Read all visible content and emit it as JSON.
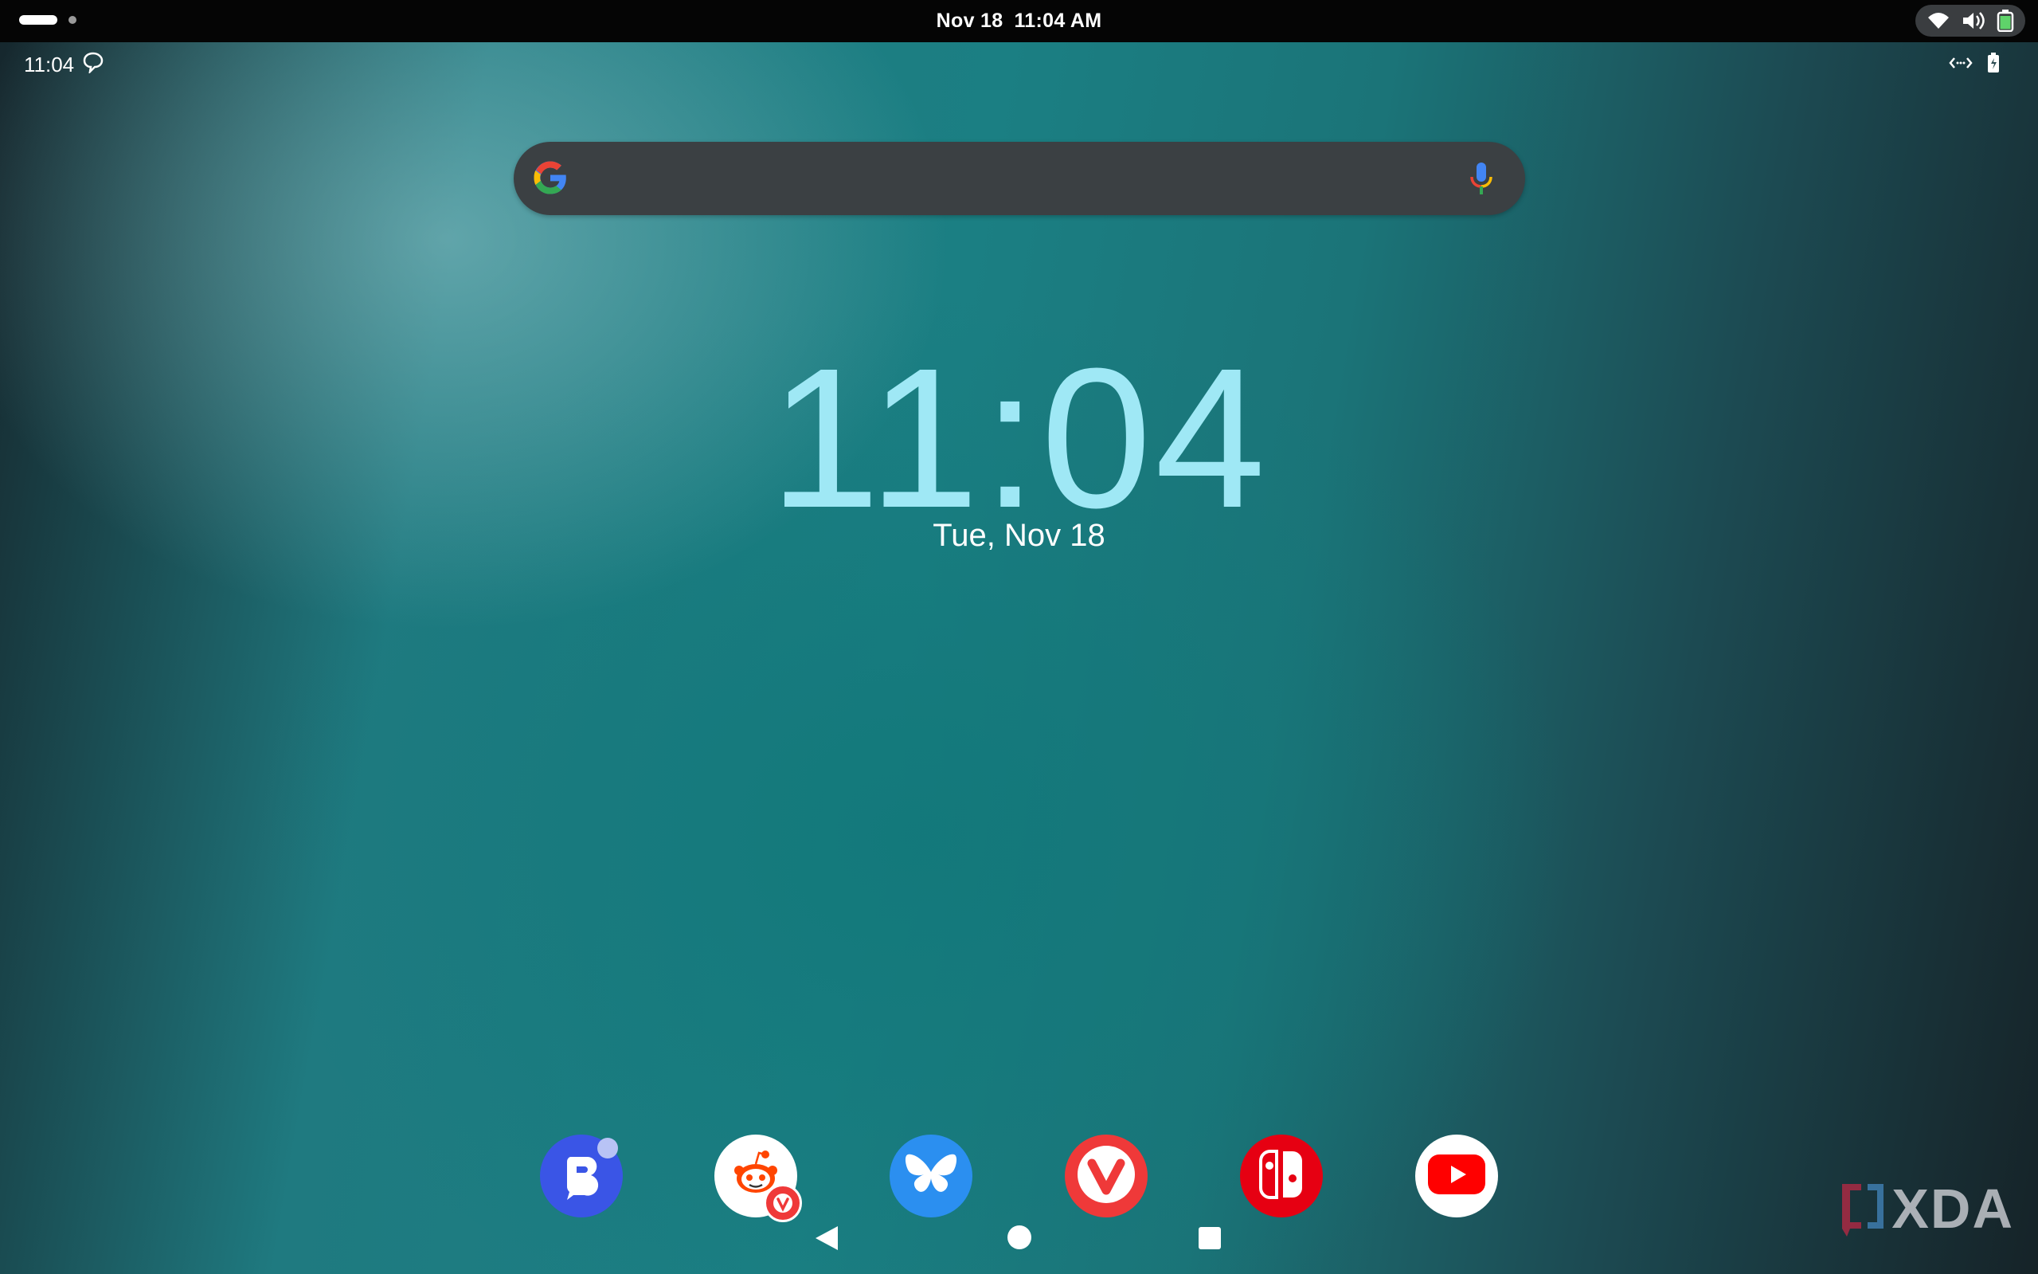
{
  "topbar": {
    "date": "Nov 18",
    "time": "11:04 AM",
    "tray_icons": [
      "wifi-icon",
      "volume-icon",
      "battery-charging-icon"
    ]
  },
  "android_status": {
    "time": "11:04",
    "left_icon": "speech-bubble-icon",
    "right_icons": [
      "code-arrows-icon",
      "battery-icon"
    ]
  },
  "search": {
    "placeholder": "",
    "left_icon": "google-logo-icon",
    "right_icon": "microphone-icon"
  },
  "clock_widget": {
    "time": "11:04",
    "date": "Tue, Nov 18"
  },
  "dock": {
    "apps": [
      {
        "name": "Beeper",
        "icon": "beeper-icon",
        "color": "#3a55e6"
      },
      {
        "name": "Reddit",
        "icon": "reddit-icon",
        "color": "#ff4500"
      },
      {
        "name": "Bluesky",
        "icon": "bluesky-icon",
        "color": "#2b8ff0"
      },
      {
        "name": "Vivaldi",
        "icon": "vivaldi-icon",
        "color": "#ef3939"
      },
      {
        "name": "Nintendo Switch",
        "icon": "nintendo-switch-icon",
        "color": "#e60012"
      },
      {
        "name": "YouTube",
        "icon": "youtube-icon",
        "color": "#ff0000"
      }
    ]
  },
  "navigation": [
    "back-button",
    "home-button",
    "recents-button"
  ],
  "watermark": {
    "text": "XDA"
  }
}
